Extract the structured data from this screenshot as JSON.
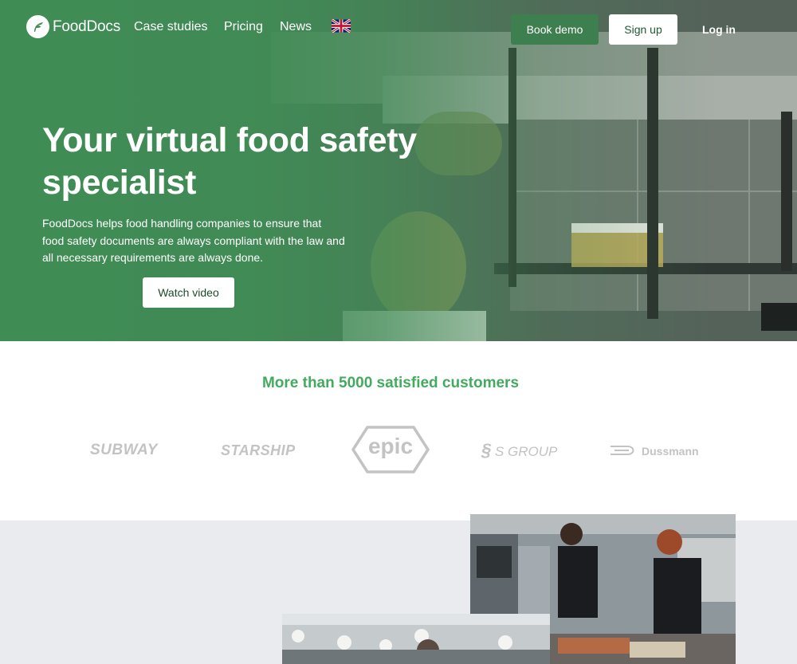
{
  "nav": {
    "logo_text": "FoodDocs",
    "links": [
      "Case studies",
      "Pricing",
      "News"
    ],
    "language_icon": "uk-flag-icon",
    "book_demo": "Book demo",
    "sign_up": "Sign up",
    "log_in": "Log in"
  },
  "hero": {
    "title": "Your virtual food safety specialist",
    "description": "FoodDocs helps food handling companies to ensure that food safety documents are always compliant with the law and all necessary requirements are always done.",
    "watch_video": "Watch video"
  },
  "customers": {
    "title": "More than 5000 satisfied customers",
    "logos": [
      "SUBWAY",
      "STARSHIP",
      "epic",
      "S GROUP",
      "Dussmann"
    ]
  },
  "colors": {
    "brand_green": "#408c55",
    "accent_green": "#44aa5f",
    "button_green": "#3d7f4f",
    "section_gray": "#e9ebee"
  }
}
